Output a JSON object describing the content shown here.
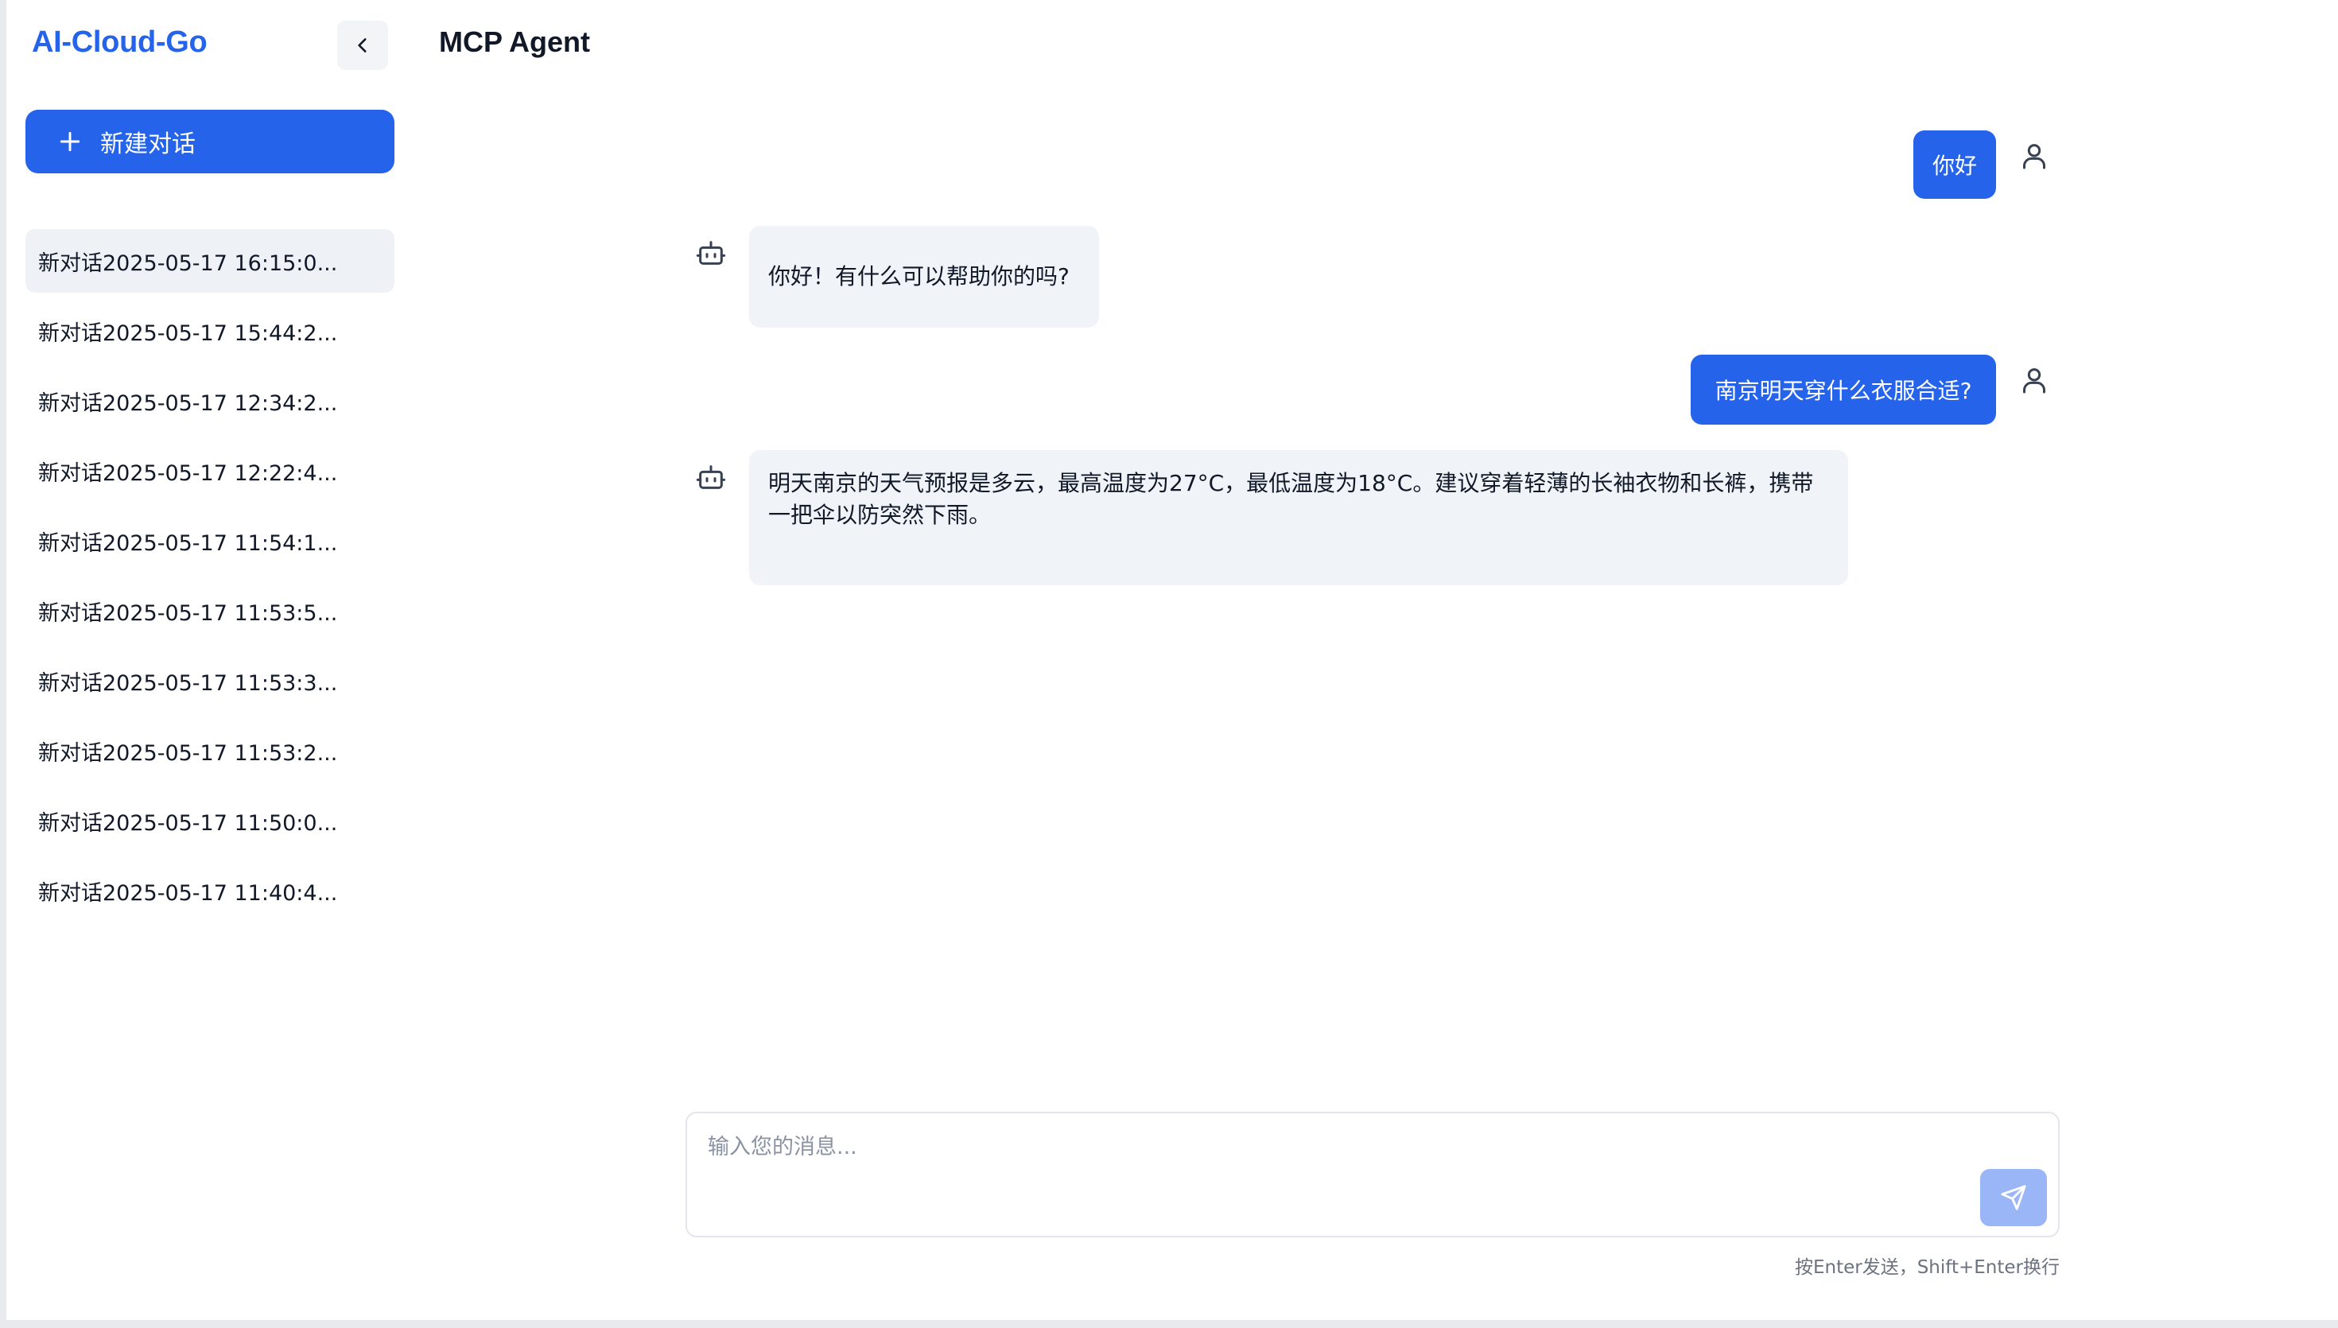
{
  "app": {
    "logo": "AI-Cloud-Go",
    "page_title": "MCP Agent"
  },
  "sidebar": {
    "new_chat_label": "新建对话",
    "history": [
      "新对话2025-05-17 16:15:0...",
      "新对话2025-05-17 15:44:2...",
      "新对话2025-05-17 12:34:2...",
      "新对话2025-05-17 12:22:4...",
      "新对话2025-05-17 11:54:1...",
      "新对话2025-05-17 11:53:5...",
      "新对话2025-05-17 11:53:3...",
      "新对话2025-05-17 11:53:2...",
      "新对话2025-05-17 11:50:0...",
      "新对话2025-05-17 11:40:4..."
    ]
  },
  "messages": [
    {
      "role": "user",
      "text": "你好"
    },
    {
      "role": "assistant",
      "text": "你好！有什么可以帮助你的吗?"
    },
    {
      "role": "user",
      "text": "南京明天穿什么衣服合适?"
    },
    {
      "role": "assistant",
      "text": "明天南京的天气预报是多云，最高温度为27°C，最低温度为18°C。建议穿着轻薄的长袖衣物和长裤，携带一把伞以防突然下雨。"
    }
  ],
  "input": {
    "placeholder": "输入您的消息...",
    "value": "",
    "hint": "按Enter发送，Shift+Enter换行"
  },
  "icons": {
    "collapse": "chevron-left-icon",
    "new_chat": "plus-icon",
    "user": "user-icon",
    "bot": "bot-icon",
    "send": "send-icon"
  },
  "colors": {
    "accent": "#2563eb",
    "active_item_bg": "#eef1f6",
    "bot_bubble_bg": "#f0f3f7",
    "send_disabled": "#9ab6f6"
  }
}
